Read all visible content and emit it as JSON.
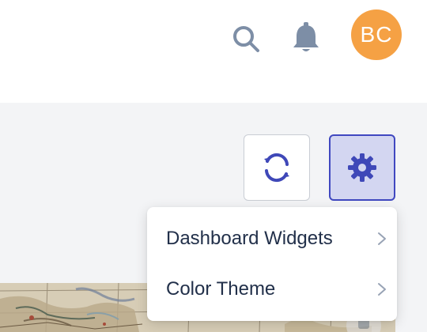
{
  "header": {
    "search_icon": "search-icon",
    "notifications_icon": "bell-icon",
    "avatar_initials": "BC",
    "avatar_color": "#f5a144"
  },
  "toolbar": {
    "refresh_icon": "refresh-icon",
    "settings_icon": "gear-icon",
    "accent_color": "#4048c0"
  },
  "settings_menu": {
    "items": [
      {
        "label": "Dashboard Widgets",
        "icon": "chevron-right-icon"
      },
      {
        "label": "Color Theme",
        "icon": "chevron-right-icon"
      }
    ]
  }
}
